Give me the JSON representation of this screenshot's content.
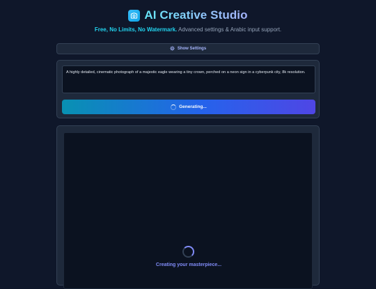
{
  "header": {
    "logo_icon": "camera-icon",
    "title": "AI Creative Studio",
    "subtitle_highlight": "Free, No Limits, No Watermark.",
    "subtitle_rest": " Advanced settings & Arabic input support."
  },
  "settings": {
    "icon": "gear-icon",
    "label": "Show Settings"
  },
  "prompt": {
    "value": "A highly detailed, cinematic photograph of a majestic eagle wearing a tiny crown, perched on a neon sign in a cyberpunk city, 8k resolution."
  },
  "generate_button": {
    "icon": "spinner-icon",
    "label": "Generating..."
  },
  "result": {
    "loader_icon": "spinner-icon",
    "status": "Creating your masterpiece..."
  },
  "colors": {
    "background": "#0f172a",
    "panel": "#1e293b",
    "accent_cyan": "#22d3ee",
    "accent_indigo": "#818cf8"
  }
}
